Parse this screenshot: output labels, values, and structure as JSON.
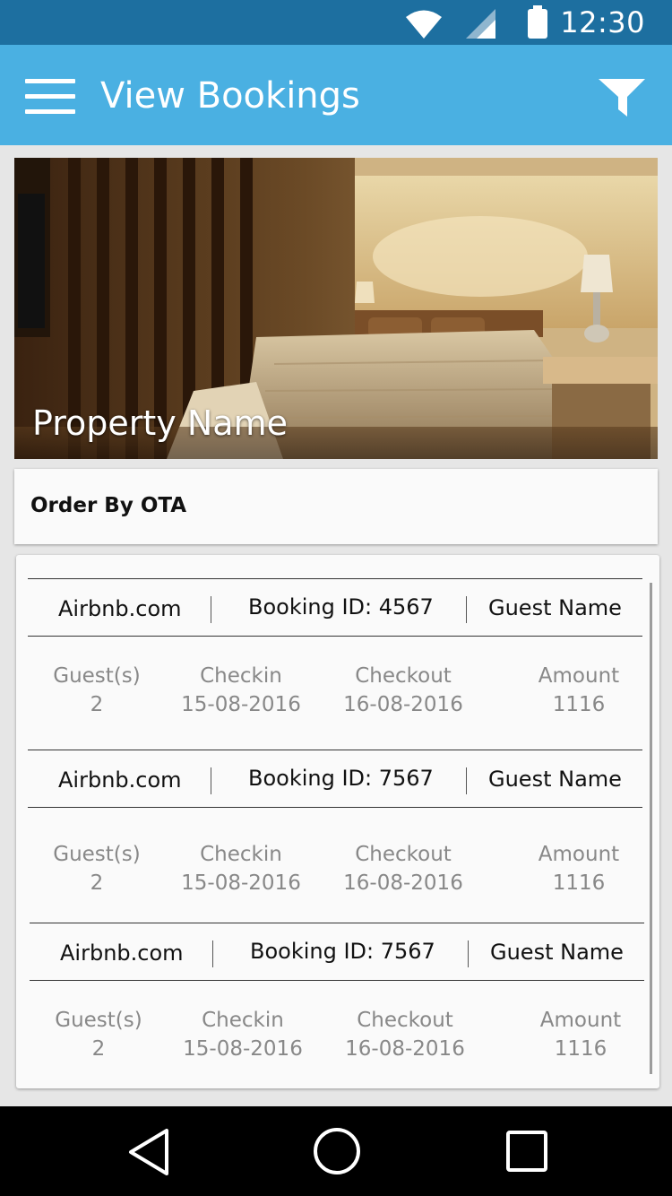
{
  "status_bar": {
    "time": "12:30",
    "icons": [
      "wifi-icon",
      "cellular-signal-icon",
      "battery-icon"
    ]
  },
  "app_bar": {
    "title": "View Bookings",
    "icons": [
      "menu-icon",
      "filter-icon"
    ]
  },
  "property": {
    "name": "Property Name"
  },
  "order_by": {
    "label": "Order By OTA"
  },
  "bookings": [
    {
      "ota": "Airbnb.com",
      "booking_id": "Booking ID: 4567",
      "guest_name": "Guest Name",
      "guests_label": "Guest(s)",
      "guests": "2",
      "checkin_label": "Checkin",
      "checkin": "15-08-2016",
      "checkout_label": "Checkout",
      "checkout": "16-08-2016",
      "amount_label": "Amount",
      "amount": "1116"
    },
    {
      "ota": "Airbnb.com",
      "booking_id": "Booking ID: 7567",
      "guest_name": "Guest Name",
      "guests_label": "Guest(s)",
      "guests": "2",
      "checkin_label": "Checkin",
      "checkin": "15-08-2016",
      "checkout_label": "Checkout",
      "checkout": "16-08-2016",
      "amount_label": "Amount",
      "amount": "1116"
    },
    {
      "ota": "Airbnb.com",
      "booking_id": "Booking ID: 7567",
      "guest_name": "Guest Name",
      "guests_label": "Guest(s)",
      "guests": "2",
      "checkin_label": "Checkin",
      "checkin": "15-08-2016",
      "checkout_label": "Checkout",
      "checkout": "16-08-2016",
      "amount_label": "Amount",
      "amount": "1116"
    }
  ],
  "nav_bar": {
    "icons": [
      "back-icon",
      "home-icon",
      "recents-icon"
    ]
  },
  "colors": {
    "status_bar": "#1d6fa0",
    "app_bar": "#4ab0e2",
    "background": "#e6e6e6"
  }
}
